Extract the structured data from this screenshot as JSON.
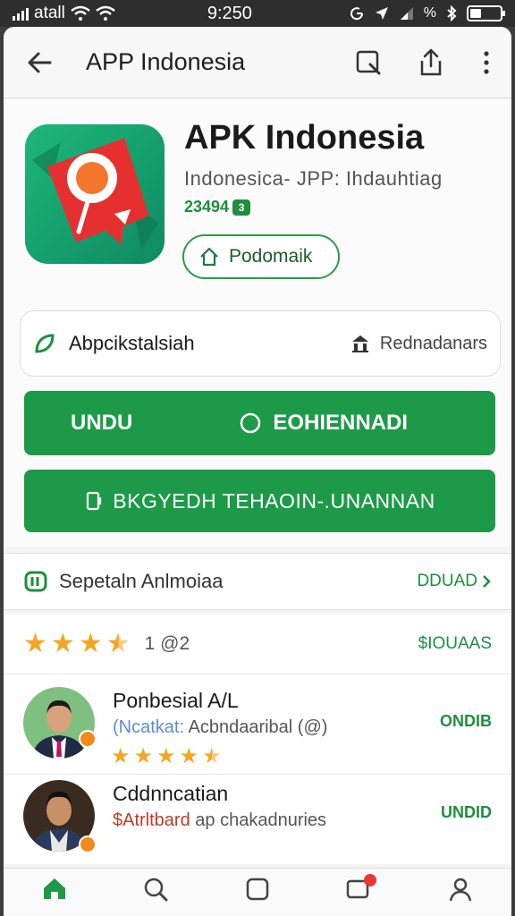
{
  "status_bar": {
    "carrier": "atall",
    "time": "9:250",
    "indicators": "%"
  },
  "app_bar": {
    "title": "APP Indonesia"
  },
  "app": {
    "name": "APK Indonesia",
    "subtitle": "Indonesica- JPP: Ihdauhtiag",
    "meta": "23494",
    "meta_chip": "3",
    "tag_button": "Podomaik"
  },
  "info_card": {
    "left_label": "Abpcikstalsiah",
    "right_label": "Rednadanars"
  },
  "buttons": {
    "primary_left": "UNDU",
    "primary_right": "EOHIENNADI",
    "secondary": "BKGYEDH TEHAOIN-.UNANNAN"
  },
  "section": {
    "label": "Sepetaln Anlmoiaa",
    "action": "DDUAD"
  },
  "rating": {
    "stars": 3.5,
    "count": "1 @2",
    "action": "$IOUAAS"
  },
  "reviews": [
    {
      "name": "Ponbesial A/L",
      "desc_accent": "(Ncatkat:",
      "desc": "Acbndaaribal (@)",
      "stars": 4.5,
      "action": "ONDIB"
    },
    {
      "name": "Cddnncatian",
      "desc_accent": "$Atrltbard",
      "desc": "ap chakadnuries",
      "action": "UNDID"
    }
  ],
  "colors": {
    "accent": "#1d9a48",
    "star": "#f4a623",
    "status_bar": "#2e2e2e"
  },
  "nav_icons": [
    "home-icon",
    "search-icon",
    "library-icon",
    "notifications-icon",
    "profile-icon"
  ]
}
